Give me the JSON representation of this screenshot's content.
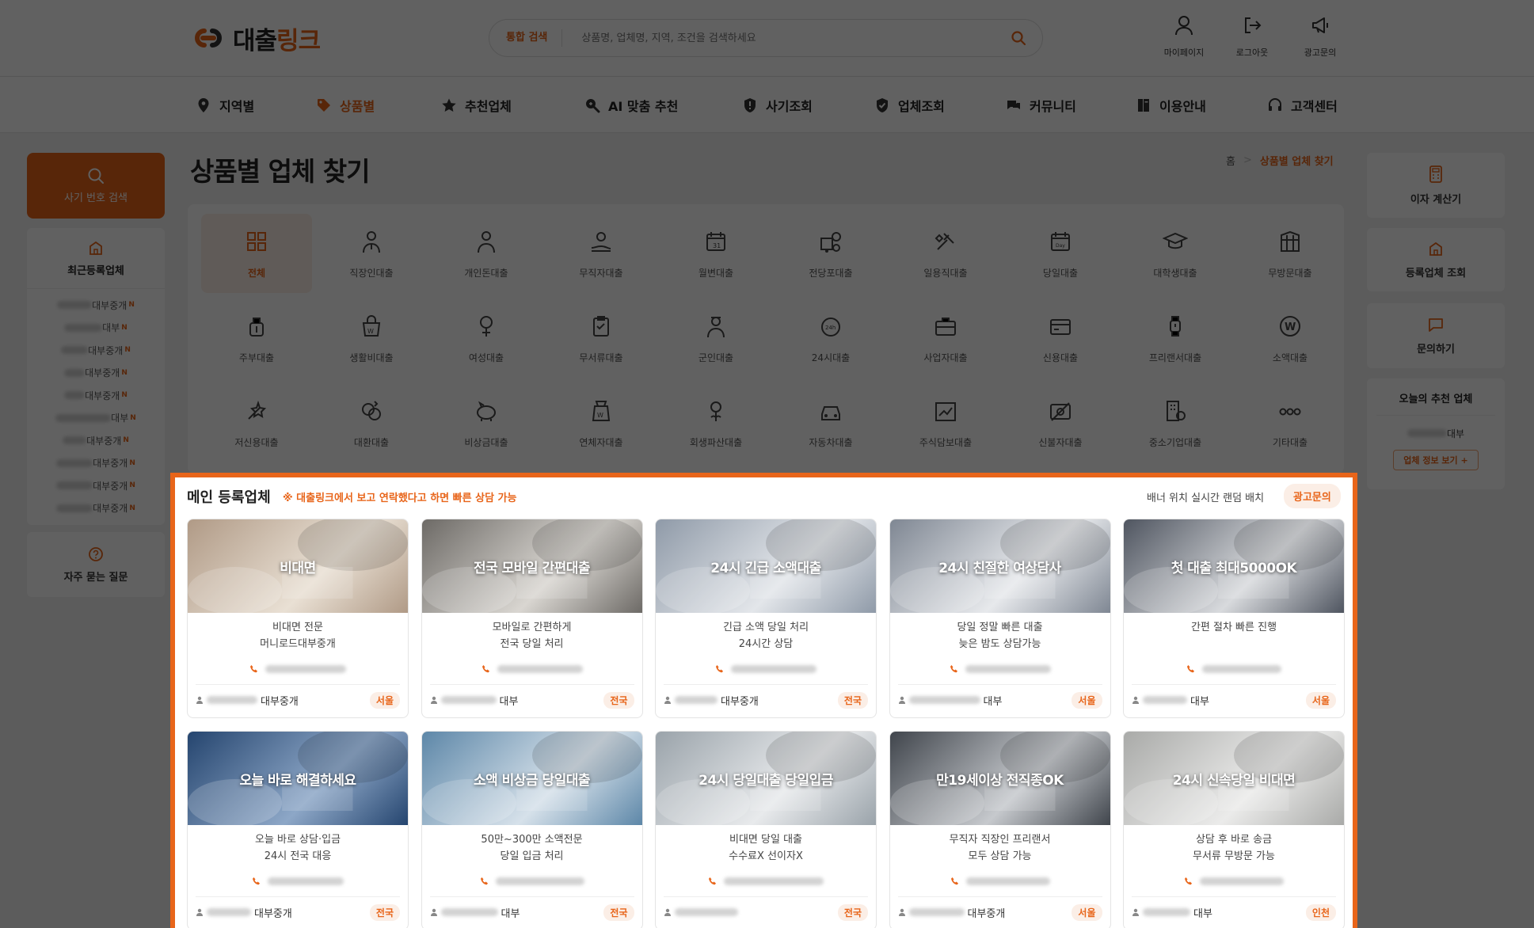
{
  "header": {
    "logo_main": "대출",
    "logo_accent": "링크",
    "search_label": "통합 검색",
    "search_placeholder": "상품명, 업체명, 지역, 조건을 검색하세요",
    "utils": [
      {
        "label": "마이페이지",
        "icon": "user-icon"
      },
      {
        "label": "로그아웃",
        "icon": "logout-icon"
      },
      {
        "label": "광고문의",
        "icon": "megaphone-icon"
      }
    ]
  },
  "nav": [
    {
      "label": "지역별",
      "icon": "map-pin-icon",
      "active": false
    },
    {
      "label": "상품별",
      "icon": "tag-icon",
      "active": true
    },
    {
      "label": "추천업체",
      "icon": "star-icon",
      "active": false
    },
    {
      "label": "AI 맞춤 추천",
      "icon": "search-ai-icon",
      "active": false
    },
    {
      "label": "사기조회",
      "icon": "shield-alert-icon",
      "active": false
    },
    {
      "label": "업체조회",
      "icon": "shield-check-icon",
      "active": false
    },
    {
      "label": "커뮤니티",
      "icon": "chat-icon",
      "active": false
    },
    {
      "label": "이용안내",
      "icon": "book-icon",
      "active": false
    },
    {
      "label": "고객센터",
      "icon": "headset-icon",
      "active": false
    }
  ],
  "left_sidebar": {
    "sos_label": "사기 번호 검색",
    "recent_title": "최근등록업체",
    "recent_items": [
      "대부중개",
      "대부",
      "대부중개",
      "대부중개",
      "대부중개",
      "대부",
      "대부중개",
      "대부중개",
      "대부중개",
      "대부중개"
    ],
    "new_badge": "N",
    "faq_label": "자주 묻는 질문"
  },
  "right_sidebar": {
    "calc_label": "이자 계산기",
    "lookup_label": "등록업체 조회",
    "contact_label": "문의하기",
    "today_title": "오늘의 추천 업체",
    "today_company": "대부",
    "today_button": "업체 정보 보기 +"
  },
  "page": {
    "title": "상품별 업체 찾기",
    "breadcrumb_home": "홈",
    "breadcrumb_sep": ">",
    "breadcrumb_current": "상품별 업체 찾기"
  },
  "categories": [
    "전체",
    "직장인대출",
    "개인돈대출",
    "무직자대출",
    "월변대출",
    "전당포대출",
    "일용직대출",
    "당일대출",
    "대학생대출",
    "무방문대출",
    "주부대출",
    "생활비대출",
    "여성대출",
    "무서류대출",
    "군인대출",
    "24시대출",
    "사업자대출",
    "신용대출",
    "프리랜서대출",
    "소액대출",
    "저신용대출",
    "대환대출",
    "비상금대출",
    "연체자대출",
    "회생파산대출",
    "자동차대출",
    "주식담보대출",
    "신불자대출",
    "중소기업대출",
    "기타대출"
  ],
  "featured": {
    "title": "메인 등록업체",
    "note": "※ 대출링크에서 보고 연락했다고 하면 빠른 상담 가능",
    "right_text": "배너 위치 실시간 랜덤 배치",
    "ad_button": "광고문의",
    "cards": [
      {
        "title": "비대면",
        "desc1": "비대면 전문",
        "desc2": "머니로드대부중개",
        "company": "대부중개",
        "region": "서울"
      },
      {
        "title": "전국 모바일 간편대출",
        "desc1": "모바일로 간편하게",
        "desc2": "전국 당일 처리",
        "company": "대부",
        "region": "전국"
      },
      {
        "title": "24시 긴급 소액대출",
        "desc1": "긴급 소액 당일 처리",
        "desc2": "24시간 상담",
        "company": "대부중개",
        "region": "전국"
      },
      {
        "title": "24시 친절한 여상담사",
        "desc1": "당일 정말 빠른 대출",
        "desc2": "늦은 밤도 상담가능",
        "company": "대부",
        "region": "서울"
      },
      {
        "title": "첫 대출 최대5000OK",
        "desc1": "간편 절차 빠른 진행",
        "desc2": "",
        "company": "대부",
        "region": "서울"
      },
      {
        "title": "오늘 바로 해결하세요",
        "desc1": "오늘 바로 상담·입금",
        "desc2": "24시 전국 대응",
        "company": "대부중개",
        "region": "전국"
      },
      {
        "title": "소액 비상금 당일대출",
        "desc1": "50만~300만 소액전문",
        "desc2": "당일 입금 처리",
        "company": "대부",
        "region": "전국"
      },
      {
        "title": "24시 당일대출 당일입금",
        "desc1": "비대면 당일 대출",
        "desc2": "수수료X 선이자X",
        "company": "",
        "region": "전국"
      },
      {
        "title": "만19세이상 전직종OK",
        "desc1": "무직자 직장인 프리랜서",
        "desc2": "모두 상담 가능",
        "company": "대부중개",
        "region": "서울"
      },
      {
        "title": "24시 신속당일 비대면",
        "desc1": "상담 후 바로 송금",
        "desc2": "무서류 무방문 가능",
        "company": "대부",
        "region": "인천"
      }
    ]
  },
  "colors": {
    "accent": "#e8651a",
    "accent_light": "#fbeee6"
  }
}
